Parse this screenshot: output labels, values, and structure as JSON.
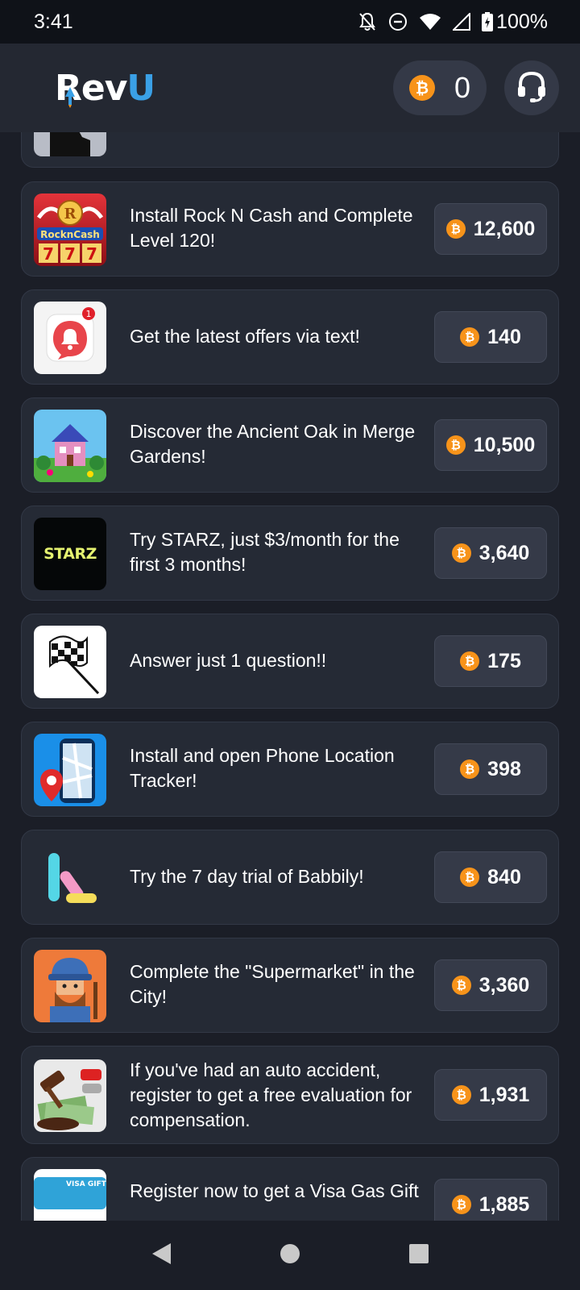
{
  "status_bar": {
    "time": "3:41",
    "battery": "100%",
    "icons": [
      "notifications-off-icon",
      "do-not-disturb-icon",
      "wifi-icon",
      "cell-signal-icon",
      "battery-icon"
    ]
  },
  "header": {
    "logo_text_main": "Rev",
    "logo_text_accent": "U",
    "balance": "0",
    "colors": {
      "accent": "#3aa0e6",
      "coin": "#f7931a"
    }
  },
  "offers": [
    {
      "title": "",
      "reward": "",
      "icon": "partial-head-icon"
    },
    {
      "title": "Install Rock N Cash and Complete Level 120!",
      "reward": "12,600",
      "icon": "rock-n-cash-icon"
    },
    {
      "title": "Get the latest offers via text!",
      "reward": "140",
      "icon": "notification-bell-icon"
    },
    {
      "title": "Discover the Ancient Oak in Merge Gardens!",
      "reward": "10,500",
      "icon": "merge-gardens-icon"
    },
    {
      "title": "Try STARZ, just $3/month for the first 3 months!",
      "reward": "3,640",
      "icon": "starz-icon",
      "icon_text": "STARZ"
    },
    {
      "title": "Answer just 1 question!!",
      "reward": "175",
      "icon": "checkered-flag-icon"
    },
    {
      "title": "Install and open Phone Location Tracker!",
      "reward": "398",
      "icon": "location-tracker-icon"
    },
    {
      "title": "Try the 7 day trial of Babbily!",
      "reward": "840",
      "icon": "babbily-icon"
    },
    {
      "title": "Complete the \"Supermarket\" in the City!",
      "reward": "3,360",
      "icon": "lumberjack-icon"
    },
    {
      "title": "If you've had an auto accident, register to get a free evaluation for compensation.",
      "reward": "1,931",
      "icon": "gavel-money-icon"
    },
    {
      "title": "Register now to get a Visa Gas Gift",
      "reward": "1,885",
      "icon": "visa-gift-card-icon",
      "icon_text": "VISA GIFT"
    }
  ],
  "nav": {
    "back": "back-icon",
    "home": "home-icon",
    "recents": "recents-icon"
  }
}
